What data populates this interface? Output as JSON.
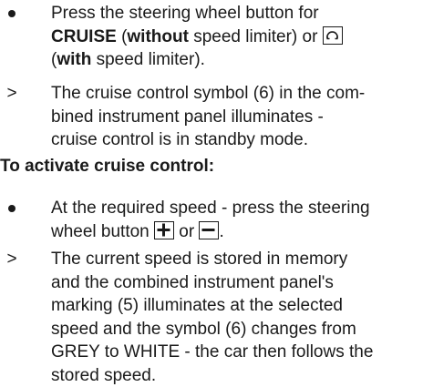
{
  "items": [
    {
      "marker": "bullet",
      "lines": [
        [
          "Press the steering wheel button for"
        ],
        [
          "CRUISE",
          " (",
          "without",
          " speed limiter) or ",
          "",
          ""
        ],
        [
          "(",
          "with",
          " speed limiter)."
        ]
      ]
    },
    {
      "marker": ">",
      "lines": [
        [
          "The cruise control symbol (6) in the com-"
        ],
        [
          "bined instrument panel illuminates -"
        ],
        [
          "cruise control is in standby mode."
        ]
      ]
    }
  ],
  "heading": "To activate cruise control:",
  "step1": {
    "line1": "At the required speed - press the steering",
    "line2_pre": "wheel button ",
    "line2_mid": " or ",
    "line2_post": "."
  },
  "step2": {
    "lines": [
      "The current speed is stored in memory",
      "and the combined instrument panel's",
      "marking (5) illuminates at the selected",
      "speed and the symbol (6) changes from",
      "GREY to WHITE - the car then follows the",
      "stored speed."
    ]
  },
  "text": {
    "press": "Press the steering wheel button for",
    "cruise": "CRUISE",
    "open_paren": " (",
    "without": "without",
    "speed_limiter_or": " speed limiter) or ",
    "paren_open2": "(",
    "with": "with",
    "speed_limiter_end": " speed limiter).",
    "arrow": ">",
    "symbol_line1": "The cruise control symbol (6) in the com-",
    "symbol_line2": "bined instrument panel illuminates -",
    "symbol_line3": "cruise control is in standby mode."
  },
  "icons": {
    "speed_limiter": "speed-limiter-icon",
    "plus": "plus-icon",
    "minus": "minus-icon"
  }
}
